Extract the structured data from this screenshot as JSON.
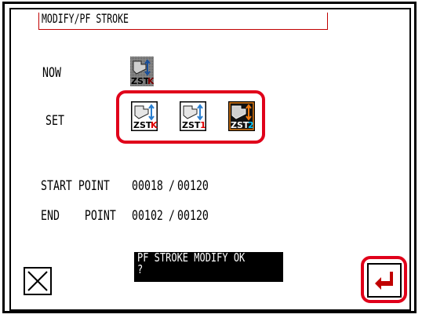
{
  "header": {
    "title": "MODIFY/PF STROKE"
  },
  "now": {
    "label": "NOW",
    "icon": "zstk-icon",
    "icon_text": "ZSTK",
    "sub": "K"
  },
  "set": {
    "label": "SET",
    "options": [
      {
        "name": "zstk",
        "text": "ZST",
        "sub": "K",
        "sub_color": "#e00000",
        "selected": false
      },
      {
        "name": "zst1",
        "text": "ZST",
        "sub": "1",
        "sub_color": "#e00000",
        "selected": false
      },
      {
        "name": "zst2",
        "text": "ZST",
        "sub": "2",
        "sub_color": "#00c8ff",
        "selected": true
      }
    ]
  },
  "start_point": {
    "label": "START POINT",
    "value": "00018",
    "separator": "/",
    "total": "00120"
  },
  "end_point": {
    "label": "END    POINT",
    "value": "00102",
    "separator": "/",
    "total": "00120"
  },
  "message": {
    "line1": "PF STROKE MODIFY OK",
    "line2": "?"
  },
  "colors": {
    "highlight": "#e0001a",
    "enter_arrow": "#c00000",
    "icon_arrow": "#2a7fd0"
  }
}
